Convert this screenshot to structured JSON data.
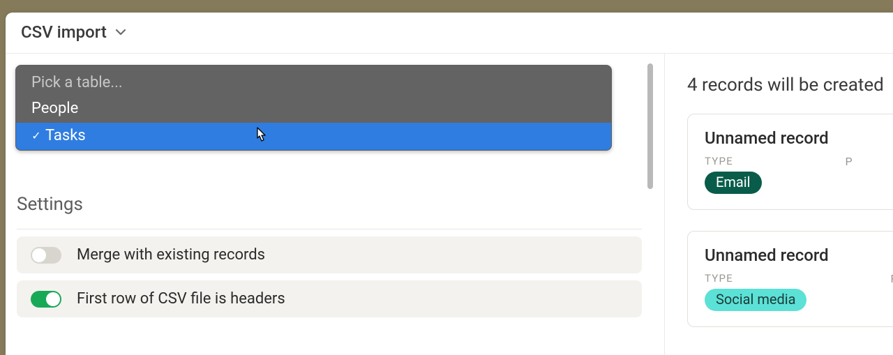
{
  "header": {
    "title": "CSV import"
  },
  "dropdown": {
    "placeholder": "Pick a table...",
    "options": [
      "People",
      "Tasks"
    ],
    "selected": "Tasks"
  },
  "settings": {
    "title": "Settings",
    "rows": [
      {
        "label": "Merge with existing records",
        "on": false
      },
      {
        "label": "First row of CSV file is headers",
        "on": true
      }
    ]
  },
  "preview": {
    "heading": "4 records will be created",
    "records": [
      {
        "title": "Unnamed record",
        "type_label": "TYPE",
        "type_value": "Email",
        "type_pill": "pill-email",
        "extra_label": "P"
      },
      {
        "title": "Unnamed record",
        "type_label": "TYPE",
        "type_value": "Social media",
        "type_pill": "pill-social",
        "extra_label": "P"
      }
    ]
  }
}
